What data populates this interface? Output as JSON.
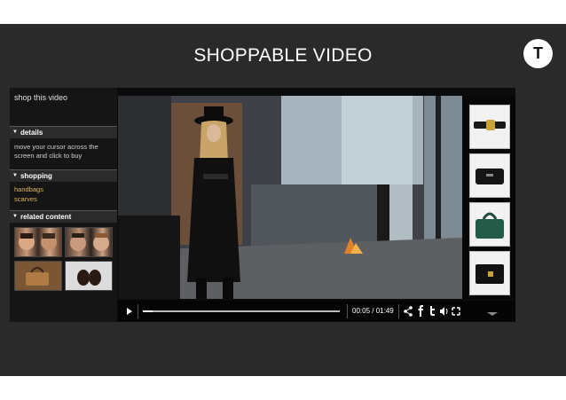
{
  "slide": {
    "title": "SHOPPABLE VIDEO",
    "logo_letter": "T"
  },
  "sidebar": {
    "heading": "shop this video",
    "sections": [
      {
        "label": "details"
      },
      {
        "label": "shopping"
      },
      {
        "label": "related content"
      }
    ],
    "details_text": "move your cursor across the screen and click to buy",
    "shopping_links": [
      "handbags",
      "scarves"
    ]
  },
  "player": {
    "time_current": "00:05",
    "time_separator": "/",
    "time_total": "01:49",
    "progress_fraction": 0.05
  },
  "colors": {
    "background": "#2a2a2a",
    "link": "#d9b45a",
    "panel": "#151515"
  },
  "icons": [
    "play-icon",
    "share-icon",
    "facebook-icon",
    "twitter-icon",
    "volume-icon",
    "fullscreen-icon",
    "scroll-down-icon"
  ]
}
